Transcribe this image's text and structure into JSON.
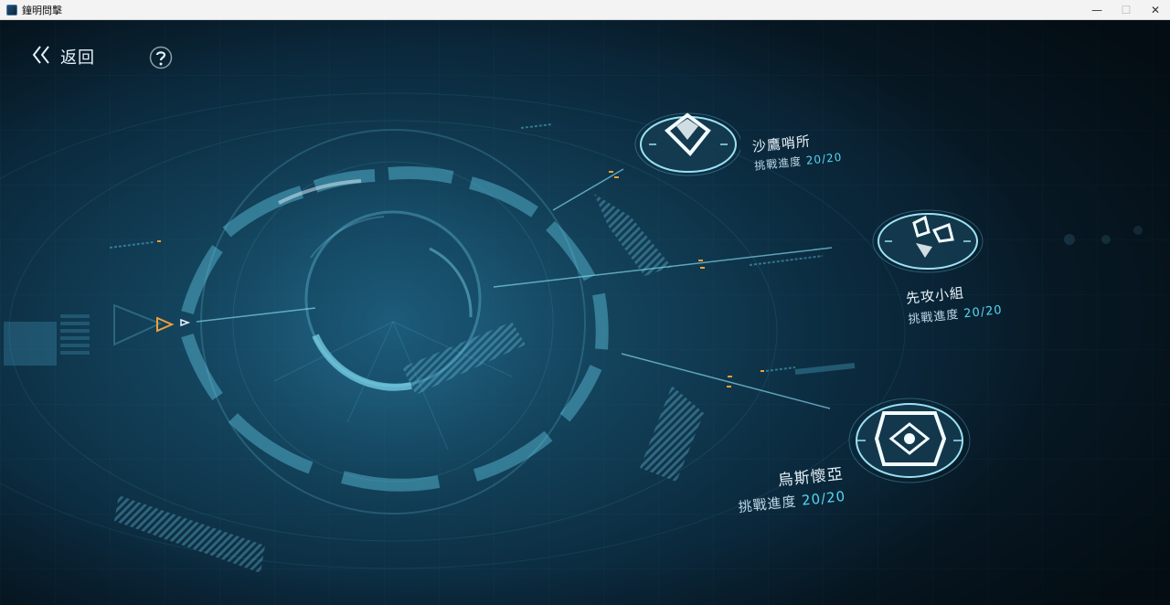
{
  "window": {
    "title": "鐘明問擊",
    "controls": {
      "minimize": "—",
      "maximize": "☐",
      "close": "✕"
    }
  },
  "nav": {
    "back_label": "返回",
    "back_icon": "double-chevron-left-icon",
    "help_icon": "question-mark-icon"
  },
  "stages": [
    {
      "name": "沙鷹哨所",
      "progress_label": "挑戰進度",
      "progress_value": "20/20",
      "icon": "eagle-emblem-icon"
    },
    {
      "name": "先攻小組",
      "progress_label": "挑戰進度",
      "progress_value": "20/20",
      "icon": "armor-emblem-icon"
    },
    {
      "name": "烏斯懷亞",
      "progress_label": "挑戰進度",
      "progress_value": "20/20",
      "icon": "eye-emblem-icon"
    }
  ],
  "colors": {
    "accent_cyan": "#55d6f2",
    "accent_orange": "#f0a03a",
    "hud_line": "#5fc3de"
  }
}
